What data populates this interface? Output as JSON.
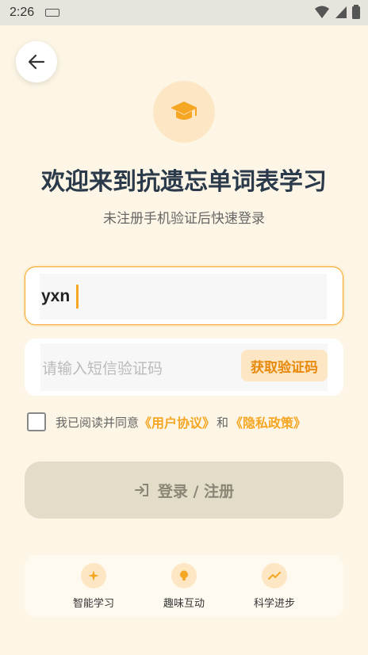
{
  "status_bar": {
    "time": "2:26"
  },
  "header": {
    "title": "欢迎来到抗遗忘单词表学习",
    "subtitle": "未注册手机验证后快速登录"
  },
  "form": {
    "phone_value": "yxn",
    "code_placeholder": "请输入短信验证码",
    "get_code_label": "获取验证码",
    "agree_prefix": "我已阅读并同意",
    "user_agreement": "《用户协议》",
    "and_text": "和",
    "privacy_policy": "《隐私政策》",
    "login_label": "登录 / 注册"
  },
  "features": [
    {
      "label": "智能学习",
      "icon": "sparkle-icon"
    },
    {
      "label": "趣味互动",
      "icon": "lightbulb-icon"
    },
    {
      "label": "科学进步",
      "icon": "trend-up-icon"
    }
  ],
  "colors": {
    "accent": "#f5a623",
    "background": "#fdf6e6",
    "title": "#2b3a4a",
    "button_disabled": "#e2dcc8"
  }
}
